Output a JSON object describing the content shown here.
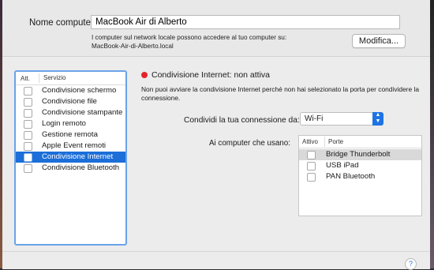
{
  "computer_name": {
    "label": "Nome computer:",
    "value": "MacBook Air di Alberto",
    "help_line1": "I computer sul network locale possono accedere al tuo computer su:",
    "help_line2": "MacBook-Air-di-Alberto.local",
    "edit_button": "Modifica..."
  },
  "services": {
    "col_on": "Att.",
    "col_service": "Servizio",
    "items": [
      {
        "label": "Condivisione schermo",
        "checked": false,
        "selected": false
      },
      {
        "label": "Condivisione file",
        "checked": false,
        "selected": false
      },
      {
        "label": "Condivisione stampante",
        "checked": false,
        "selected": false
      },
      {
        "label": "Login remoto",
        "checked": false,
        "selected": false
      },
      {
        "label": "Gestione remota",
        "checked": false,
        "selected": false
      },
      {
        "label": "Apple Event remoti",
        "checked": false,
        "selected": false
      },
      {
        "label": "Condivisione Internet",
        "checked": false,
        "selected": true
      },
      {
        "label": "Condivisione Bluetooth",
        "checked": false,
        "selected": false
      }
    ]
  },
  "status": {
    "color": "#e3262b",
    "title": "Condivisione Internet: non attiva",
    "description": "Non puoi avviare la condivisione Internet perché non hai selezionato la porta per condividere la connessione."
  },
  "share_from": {
    "label": "Condividi la tua connessione da:",
    "value": "Wi-Fi"
  },
  "to_computers": {
    "label": "Ai computer che usano:",
    "col_on": "Attivo",
    "col_ports": "Porte",
    "ports": [
      {
        "label": "Bridge Thunderbolt",
        "checked": false
      },
      {
        "label": "USB iPad",
        "checked": false
      },
      {
        "label": "PAN Bluetooth",
        "checked": false
      }
    ]
  },
  "help_button": "?"
}
